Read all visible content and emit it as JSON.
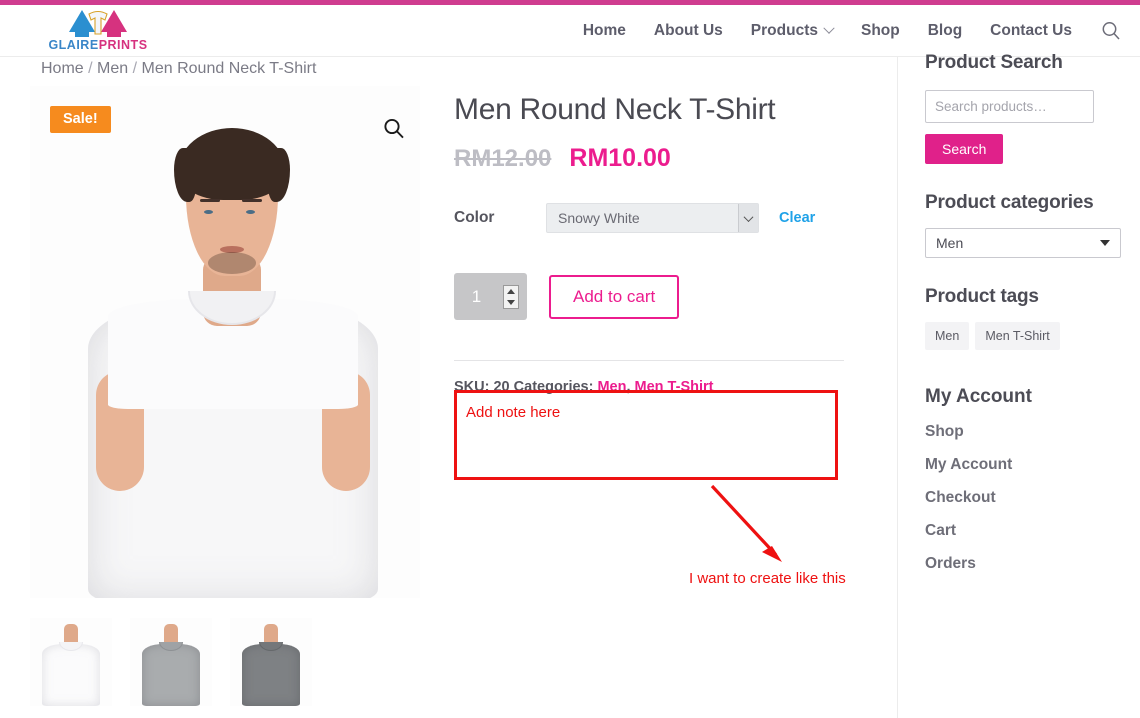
{
  "theme": {
    "accent_pink": "#ec1c8e",
    "brand_magenta": "#cf3c8f",
    "sale_orange": "#f68b1e",
    "annotation_red": "#ee1111",
    "link_blue": "#1fa2e8"
  },
  "header": {
    "logo": {
      "part1": "GLAIRE",
      "part2": "PRINTS",
      "icon": "shirt-arrows-logo"
    },
    "nav": [
      {
        "label": "Home",
        "has_dropdown": false
      },
      {
        "label": "About Us",
        "has_dropdown": false
      },
      {
        "label": "Products",
        "has_dropdown": true
      },
      {
        "label": "Shop",
        "has_dropdown": false
      },
      {
        "label": "Blog",
        "has_dropdown": false
      },
      {
        "label": "Contact Us",
        "has_dropdown": false
      }
    ],
    "search_icon": "search-icon"
  },
  "breadcrumb": {
    "items": [
      "Home",
      "Men",
      "Men Round Neck T-Shirt"
    ],
    "separator": "/"
  },
  "gallery": {
    "sale_badge": "Sale!",
    "zoom_icon": "magnifier-icon",
    "thumbnails": [
      {
        "label": "white-tshirt-thumbnail",
        "color": "#ffffff"
      },
      {
        "label": "light-gray-tshirt-thumbnail",
        "color": "#a9acae"
      },
      {
        "label": "dark-gray-tshirt-thumbnail",
        "color": "#7e8184"
      }
    ]
  },
  "product": {
    "title": "Men Round Neck T-Shirt",
    "price_old": "RM12.00",
    "price_new": "RM10.00",
    "attribute": {
      "label": "Color",
      "selected": "Snowy White",
      "clear_label": "Clear"
    },
    "quantity": "1",
    "add_to_cart_label": "Add to cart",
    "meta": {
      "sku_label": "SKU:",
      "sku_value": "20",
      "categories_label": "Categories:",
      "categories": [
        "Men",
        "Men T-Shirt"
      ]
    }
  },
  "annotation": {
    "note_placeholder": "Add note here",
    "caption": "I want to create like this",
    "arrow": "red-arrow"
  },
  "sidebar": {
    "search": {
      "heading": "Product Search",
      "placeholder": "Search products…",
      "value": "",
      "button_label": "Search"
    },
    "categories": {
      "heading": "Product categories",
      "selected": "Men"
    },
    "tags": {
      "heading": "Product tags",
      "items": [
        "Men",
        "Men T-Shirt"
      ]
    },
    "account": {
      "heading": "My Account",
      "items": [
        "Shop",
        "My Account",
        "Checkout",
        "Cart",
        "Orders"
      ]
    }
  }
}
